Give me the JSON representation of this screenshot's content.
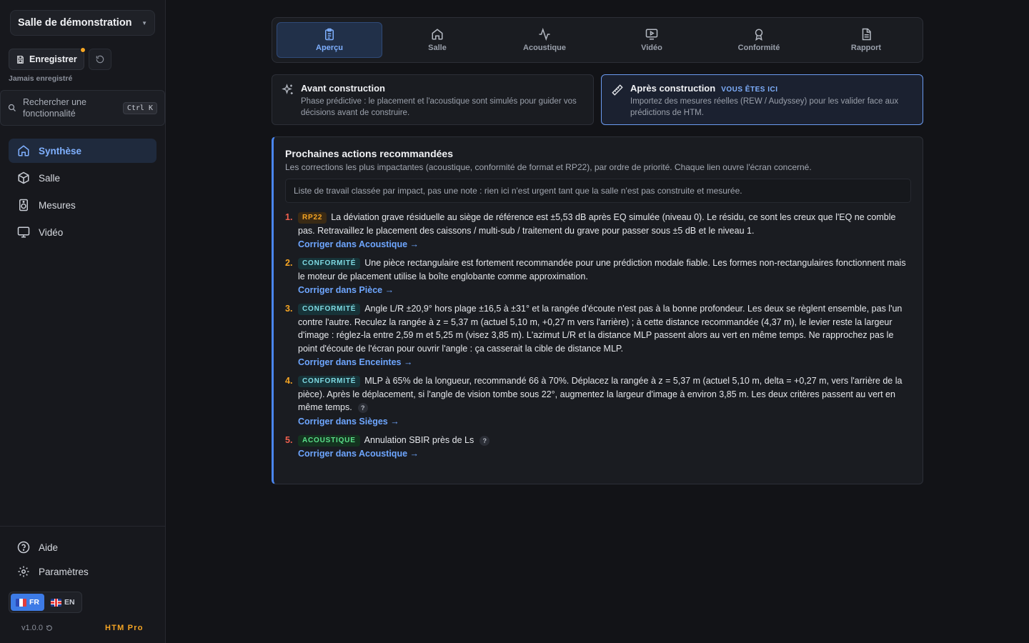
{
  "sidebar": {
    "project": "Salle de démonstration",
    "save_label": "Enregistrer",
    "save_status": "Jamais enregistré",
    "search_placeholder": "Rechercher une fonctionnalité",
    "search_shortcut": "Ctrl K",
    "nav": [
      {
        "label": "Synthèse",
        "icon": "home-icon",
        "active": true
      },
      {
        "label": "Salle",
        "icon": "cube-icon"
      },
      {
        "label": "Mesures",
        "icon": "speaker-icon"
      },
      {
        "label": "Vidéo",
        "icon": "monitor-icon"
      }
    ],
    "help_label": "Aide",
    "settings_label": "Paramètres",
    "languages": {
      "fr": "FR",
      "en": "EN",
      "selected": "FR"
    },
    "version": "v1.0.0",
    "brand": "HTM Pro"
  },
  "tabs": [
    {
      "label": "Aperçu",
      "icon": "clipboard-icon",
      "active": true
    },
    {
      "label": "Salle",
      "icon": "home-icon"
    },
    {
      "label": "Acoustique",
      "icon": "waveform-icon"
    },
    {
      "label": "Vidéo",
      "icon": "play-screen-icon"
    },
    {
      "label": "Conformité",
      "icon": "award-icon"
    },
    {
      "label": "Rapport",
      "icon": "document-icon"
    }
  ],
  "phases": {
    "before": {
      "title": "Avant construction",
      "desc": "Phase prédictive : le placement et l'acoustique sont simulés pour guider vos décisions avant de construire."
    },
    "after": {
      "title": "Après construction",
      "here": "VOUS ÊTES ICI",
      "desc": "Importez des mesures réelles (REW / Audyssey) pour les valider face aux prédictions de HTM."
    }
  },
  "recommendations": {
    "title": "Prochaines actions recommandées",
    "subtitle": "Les corrections les plus impactantes (acoustique, conformité de format et RP22), par ordre de priorité. Chaque lien ouvre l'écran concerné.",
    "note": "Liste de travail classée par impact, pas une note : rien ici n'est urgent tant que la salle n'est pas construite et mesurée.",
    "items": [
      {
        "num": "1.",
        "badge": "RP22",
        "text": "La déviation grave résiduelle au siège de référence est ±5,53 dB après EQ simulée (niveau 0). Le résidu, ce sont les creux que l'EQ ne comble pas. Retravaillez le placement des caissons / multi-sub / traitement du grave pour passer sous ±5 dB et le niveau 1.",
        "link": "Corriger dans Acoustique →"
      },
      {
        "num": "2.",
        "badge": "CONFORMITÉ",
        "text": "Une pièce rectangulaire est fortement recommandée pour une prédiction modale fiable. Les formes non-rectangulaires fonctionnent mais le moteur de placement utilise la boîte englobante comme approximation.",
        "link": "Corriger dans Pièce →"
      },
      {
        "num": "3.",
        "badge": "CONFORMITÉ",
        "text": "Angle L/R ±20,9° hors plage ±16,5 à ±31° et la rangée d'écoute n'est pas à la bonne profondeur. Les deux se règlent ensemble, pas l'un contre l'autre. Reculez la rangée à z = 5,37 m (actuel 5,10 m, +0,27 m vers l'arrière) ; à cette distance recommandée (4,37 m), le levier reste la largeur d'image : réglez-la entre 2,59 m et 5,25 m (visez 3,85 m). L'azimut L/R et la distance MLP passent alors au vert en même temps. Ne rapprochez pas le point d'écoute de l'écran pour ouvrir l'angle : ça casserait la cible de distance MLP.",
        "link": "Corriger dans Enceintes →"
      },
      {
        "num": "4.",
        "badge": "CONFORMITÉ",
        "text": "MLP à 65% de la longueur, recommandé 66 à 70%. Déplacez la rangée à z = 5,37 m (actuel 5,10 m, delta = +0,27 m, vers l'arrière de la pièce). Après le déplacement, si l'angle de vision tombe sous 22°, augmentez la largeur d'image à environ 3,85 m. Les deux critères passent au vert en même temps.",
        "link": "Corriger dans Sièges →",
        "help": "?"
      },
      {
        "num": "5.",
        "badge": "ACOUSTIQUE",
        "text": "Annulation SBIR près de Ls",
        "link": "Corriger dans Acoustique →",
        "help": "?"
      }
    ]
  }
}
